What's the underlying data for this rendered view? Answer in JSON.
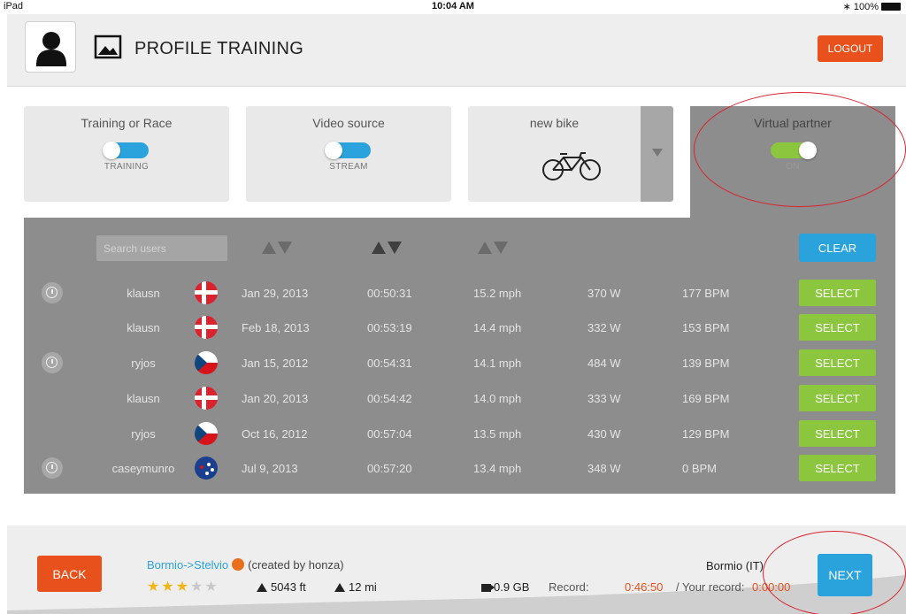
{
  "status_bar": {
    "device": "iPad",
    "time": "10:04 AM",
    "battery": "100%"
  },
  "header": {
    "title": "PROFILE TRAINING",
    "logout_label": "LOGOUT"
  },
  "cards": {
    "training": {
      "title": "Training or Race",
      "state": "TRAINING"
    },
    "video": {
      "title": "Video source",
      "state": "STREAM"
    },
    "bike": {
      "title": "new bike"
    },
    "partner": {
      "title": "Virtual partner",
      "state": "ON"
    }
  },
  "panel": {
    "search_placeholder": "Search users",
    "clear_label": "CLEAR",
    "select_label": "SELECT",
    "rows": [
      {
        "timer": true,
        "user": "klausn",
        "flag": "dk",
        "date": "Jan 29, 2013",
        "time": "00:50:31",
        "speed": "15.2 mph",
        "power": "370 W",
        "hr": "177 BPM"
      },
      {
        "timer": false,
        "user": "klausn",
        "flag": "dk",
        "date": "Feb 18, 2013",
        "time": "00:53:19",
        "speed": "14.4 mph",
        "power": "332 W",
        "hr": "153 BPM"
      },
      {
        "timer": true,
        "user": "ryjos",
        "flag": "cz",
        "date": "Jan 15, 2012",
        "time": "00:54:31",
        "speed": "14.1 mph",
        "power": "484 W",
        "hr": "139 BPM"
      },
      {
        "timer": false,
        "user": "klausn",
        "flag": "dk",
        "date": "Jan 20, 2013",
        "time": "00:54:42",
        "speed": "14.0 mph",
        "power": "333 W",
        "hr": "169 BPM"
      },
      {
        "timer": false,
        "user": "ryjos",
        "flag": "cz",
        "date": "Oct 16, 2012",
        "time": "00:57:04",
        "speed": "13.5 mph",
        "power": "430 W",
        "hr": "129 BPM"
      },
      {
        "timer": true,
        "user": "caseymunro",
        "flag": "au",
        "date": "Jul 9, 2013",
        "time": "00:57:20",
        "speed": "13.4 mph",
        "power": "348 W",
        "hr": "0 BPM"
      }
    ]
  },
  "footer": {
    "back_label": "BACK",
    "next_label": "NEXT",
    "route_name": "Bormio->Stelvio",
    "creator": "(created by honza)",
    "rating": 3,
    "rating_max": 5,
    "elevation": "5043 ft",
    "distance": "12 mi",
    "video_size": "0.9 GB",
    "record_label": "Record:",
    "record_value": "0:46:50",
    "your_record_label": "/ Your record:",
    "your_record_value": "0:00:00",
    "location": "Bormio (IT)"
  },
  "colors": {
    "orange": "#e8501c",
    "blue": "#2aa3dc",
    "green": "#8cc63f",
    "panel_gray": "#8d8d8d"
  }
}
